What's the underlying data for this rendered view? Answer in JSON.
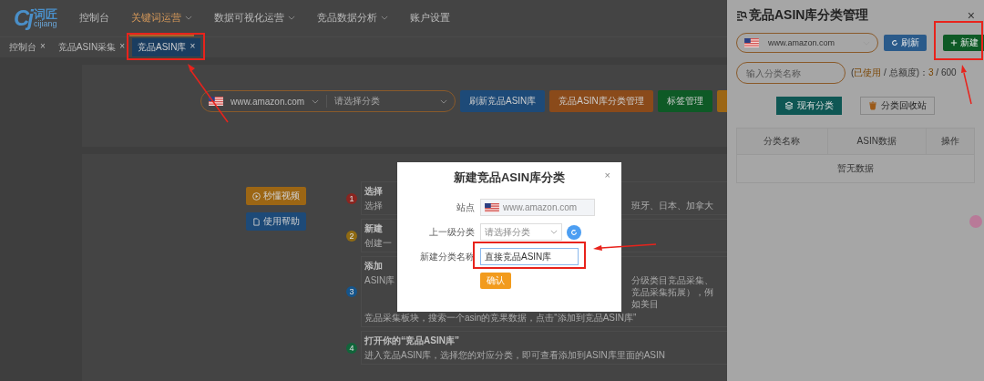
{
  "header": {
    "logo": {
      "mark": "Cj",
      "name": "词匠",
      "sub": "cijiang"
    },
    "nav": [
      {
        "label": "控制台",
        "selected": false,
        "dropdown": false
      },
      {
        "label": "关键词运营",
        "selected": true,
        "dropdown": true
      },
      {
        "label": "数据可视化运营",
        "selected": false,
        "dropdown": true
      },
      {
        "label": "竞品数据分析",
        "selected": false,
        "dropdown": true
      },
      {
        "label": "账户设置",
        "selected": false,
        "dropdown": false
      }
    ]
  },
  "tabs": [
    {
      "label": "控制台",
      "close": "×",
      "selected": false
    },
    {
      "label": "竞品ASIN采集",
      "close": "×",
      "selected": false
    },
    {
      "label": "竞品ASIN库",
      "close": "×",
      "selected": true
    }
  ],
  "toolbar": {
    "site": "www.amazon.com",
    "category_placeholder": "请选择分类",
    "buttons": [
      {
        "label": "刷新竞品ASIN库",
        "color": "#1d4a78"
      },
      {
        "label": "竞品ASIN库分类管理",
        "color": "#8a4a1a"
      },
      {
        "label": "标签管理",
        "color": "#0e5a26"
      },
      {
        "color": "#9c6614"
      }
    ]
  },
  "side_buttons": [
    {
      "label": "秒懂视频",
      "kind": "video",
      "color": "#9c6614"
    },
    {
      "label": "使用帮助",
      "kind": "doc",
      "color": "#1d4a78"
    }
  ],
  "steps": [
    {
      "number": "1",
      "color": "#8a2520",
      "title": "选择",
      "lines": [
        {
          "left": "选择",
          "right": "班牙、日本、加拿大"
        }
      ]
    },
    {
      "number": "2",
      "color": "#8f6a12",
      "title": "新建",
      "lines": [
        {
          "left": "创建一"
        }
      ]
    },
    {
      "number": "3",
      "color": "#15548a",
      "title": "添加",
      "lines": [
        {
          "left": "ASIN库",
          "right": "分级类目竞品采集、竞品采集拓展），例如美目"
        },
        {
          "full": "竞品采集板块，搜索一个asin的竞果数据，点击“添加到竞品ASIN库”"
        }
      ]
    },
    {
      "number": "4",
      "color": "#11643a",
      "title": "打开你的“竞品ASIN库”",
      "lines": [
        {
          "full": "进入竞品ASIN库，选择您的对应分类，即可查看添加到ASIN库里面的ASIN"
        }
      ]
    }
  ],
  "drawer": {
    "title": "竞品ASIN库分类管理",
    "close": "×",
    "site": "www.amazon.com",
    "refresh": "刷新",
    "new": "新建",
    "search_placeholder": "输入分类名称",
    "quota": [
      {
        "text": "(",
        "kind": "plain"
      },
      {
        "text": "已使用",
        "kind": "accent"
      },
      {
        "text": " / 总额度)：",
        "kind": "plain"
      },
      {
        "text": "3",
        "kind": "accent"
      },
      {
        "text": " / 600",
        "kind": "plain"
      }
    ],
    "tabs": [
      {
        "label": "现有分类",
        "kind": "layers",
        "selected": true
      },
      {
        "label": "分类回收站",
        "kind": "trash",
        "selected": false
      }
    ],
    "table": {
      "columns": [
        "分类名称",
        "ASIN数据",
        "操作"
      ],
      "empty": "暂无数据"
    }
  },
  "modal": {
    "title": "新建竞品ASIN库分类",
    "close": "×",
    "site": {
      "label": "站点",
      "value": "www.amazon.com",
      "disabled": true
    },
    "parent": {
      "label": "上一级分类",
      "placeholder": "请选择分类"
    },
    "name": {
      "label": "新建分类名称",
      "value": "直接竞品ASIN库"
    },
    "confirm": "确认"
  }
}
